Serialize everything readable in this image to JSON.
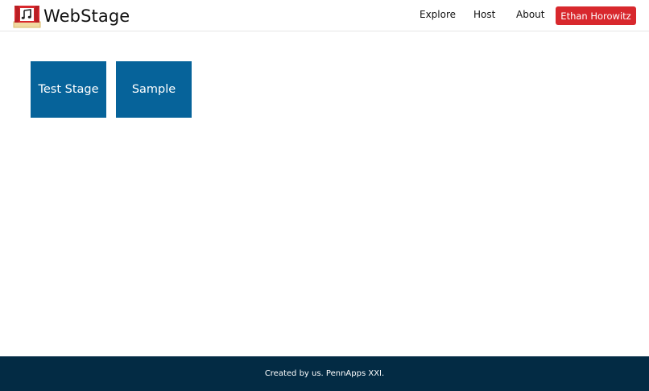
{
  "header": {
    "brand": "WebStage",
    "nav": {
      "explore": "Explore",
      "host": "Host",
      "about": "About"
    },
    "user_name": "Ethan Horowitz"
  },
  "stages": [
    {
      "label": "Test Stage"
    },
    {
      "label": "Sample"
    }
  ],
  "footer": {
    "text": "Created by us. PennApps XXI."
  },
  "colors": {
    "accent_red": "#d8282d",
    "tile_blue": "#06639a",
    "footer_navy": "#032b44"
  }
}
